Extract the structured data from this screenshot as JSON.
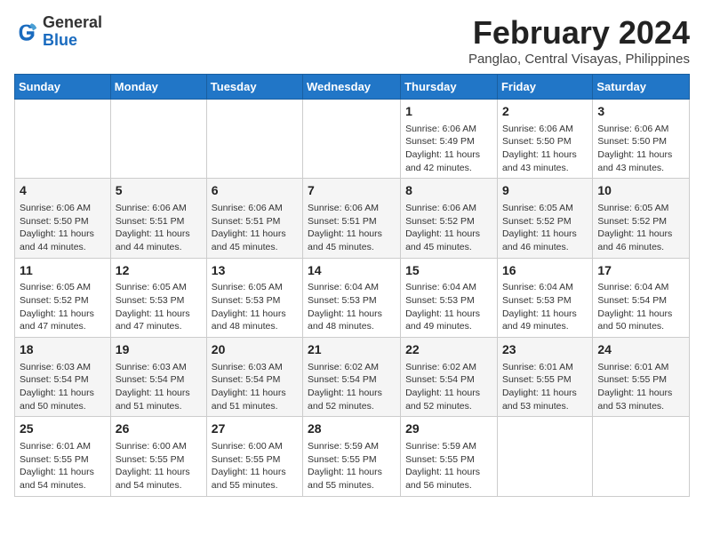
{
  "logo": {
    "general": "General",
    "blue": "Blue"
  },
  "title": "February 2024",
  "subtitle": "Panglao, Central Visayas, Philippines",
  "headers": [
    "Sunday",
    "Monday",
    "Tuesday",
    "Wednesday",
    "Thursday",
    "Friday",
    "Saturday"
  ],
  "weeks": [
    [
      {
        "day": "",
        "info": ""
      },
      {
        "day": "",
        "info": ""
      },
      {
        "day": "",
        "info": ""
      },
      {
        "day": "",
        "info": ""
      },
      {
        "day": "1",
        "info": "Sunrise: 6:06 AM\nSunset: 5:49 PM\nDaylight: 11 hours and 42 minutes."
      },
      {
        "day": "2",
        "info": "Sunrise: 6:06 AM\nSunset: 5:50 PM\nDaylight: 11 hours and 43 minutes."
      },
      {
        "day": "3",
        "info": "Sunrise: 6:06 AM\nSunset: 5:50 PM\nDaylight: 11 hours and 43 minutes."
      }
    ],
    [
      {
        "day": "4",
        "info": "Sunrise: 6:06 AM\nSunset: 5:50 PM\nDaylight: 11 hours and 44 minutes."
      },
      {
        "day": "5",
        "info": "Sunrise: 6:06 AM\nSunset: 5:51 PM\nDaylight: 11 hours and 44 minutes."
      },
      {
        "day": "6",
        "info": "Sunrise: 6:06 AM\nSunset: 5:51 PM\nDaylight: 11 hours and 45 minutes."
      },
      {
        "day": "7",
        "info": "Sunrise: 6:06 AM\nSunset: 5:51 PM\nDaylight: 11 hours and 45 minutes."
      },
      {
        "day": "8",
        "info": "Sunrise: 6:06 AM\nSunset: 5:52 PM\nDaylight: 11 hours and 45 minutes."
      },
      {
        "day": "9",
        "info": "Sunrise: 6:05 AM\nSunset: 5:52 PM\nDaylight: 11 hours and 46 minutes."
      },
      {
        "day": "10",
        "info": "Sunrise: 6:05 AM\nSunset: 5:52 PM\nDaylight: 11 hours and 46 minutes."
      }
    ],
    [
      {
        "day": "11",
        "info": "Sunrise: 6:05 AM\nSunset: 5:52 PM\nDaylight: 11 hours and 47 minutes."
      },
      {
        "day": "12",
        "info": "Sunrise: 6:05 AM\nSunset: 5:53 PM\nDaylight: 11 hours and 47 minutes."
      },
      {
        "day": "13",
        "info": "Sunrise: 6:05 AM\nSunset: 5:53 PM\nDaylight: 11 hours and 48 minutes."
      },
      {
        "day": "14",
        "info": "Sunrise: 6:04 AM\nSunset: 5:53 PM\nDaylight: 11 hours and 48 minutes."
      },
      {
        "day": "15",
        "info": "Sunrise: 6:04 AM\nSunset: 5:53 PM\nDaylight: 11 hours and 49 minutes."
      },
      {
        "day": "16",
        "info": "Sunrise: 6:04 AM\nSunset: 5:53 PM\nDaylight: 11 hours and 49 minutes."
      },
      {
        "day": "17",
        "info": "Sunrise: 6:04 AM\nSunset: 5:54 PM\nDaylight: 11 hours and 50 minutes."
      }
    ],
    [
      {
        "day": "18",
        "info": "Sunrise: 6:03 AM\nSunset: 5:54 PM\nDaylight: 11 hours and 50 minutes."
      },
      {
        "day": "19",
        "info": "Sunrise: 6:03 AM\nSunset: 5:54 PM\nDaylight: 11 hours and 51 minutes."
      },
      {
        "day": "20",
        "info": "Sunrise: 6:03 AM\nSunset: 5:54 PM\nDaylight: 11 hours and 51 minutes."
      },
      {
        "day": "21",
        "info": "Sunrise: 6:02 AM\nSunset: 5:54 PM\nDaylight: 11 hours and 52 minutes."
      },
      {
        "day": "22",
        "info": "Sunrise: 6:02 AM\nSunset: 5:54 PM\nDaylight: 11 hours and 52 minutes."
      },
      {
        "day": "23",
        "info": "Sunrise: 6:01 AM\nSunset: 5:55 PM\nDaylight: 11 hours and 53 minutes."
      },
      {
        "day": "24",
        "info": "Sunrise: 6:01 AM\nSunset: 5:55 PM\nDaylight: 11 hours and 53 minutes."
      }
    ],
    [
      {
        "day": "25",
        "info": "Sunrise: 6:01 AM\nSunset: 5:55 PM\nDaylight: 11 hours and 54 minutes."
      },
      {
        "day": "26",
        "info": "Sunrise: 6:00 AM\nSunset: 5:55 PM\nDaylight: 11 hours and 54 minutes."
      },
      {
        "day": "27",
        "info": "Sunrise: 6:00 AM\nSunset: 5:55 PM\nDaylight: 11 hours and 55 minutes."
      },
      {
        "day": "28",
        "info": "Sunrise: 5:59 AM\nSunset: 5:55 PM\nDaylight: 11 hours and 55 minutes."
      },
      {
        "day": "29",
        "info": "Sunrise: 5:59 AM\nSunset: 5:55 PM\nDaylight: 11 hours and 56 minutes."
      },
      {
        "day": "",
        "info": ""
      },
      {
        "day": "",
        "info": ""
      }
    ]
  ]
}
